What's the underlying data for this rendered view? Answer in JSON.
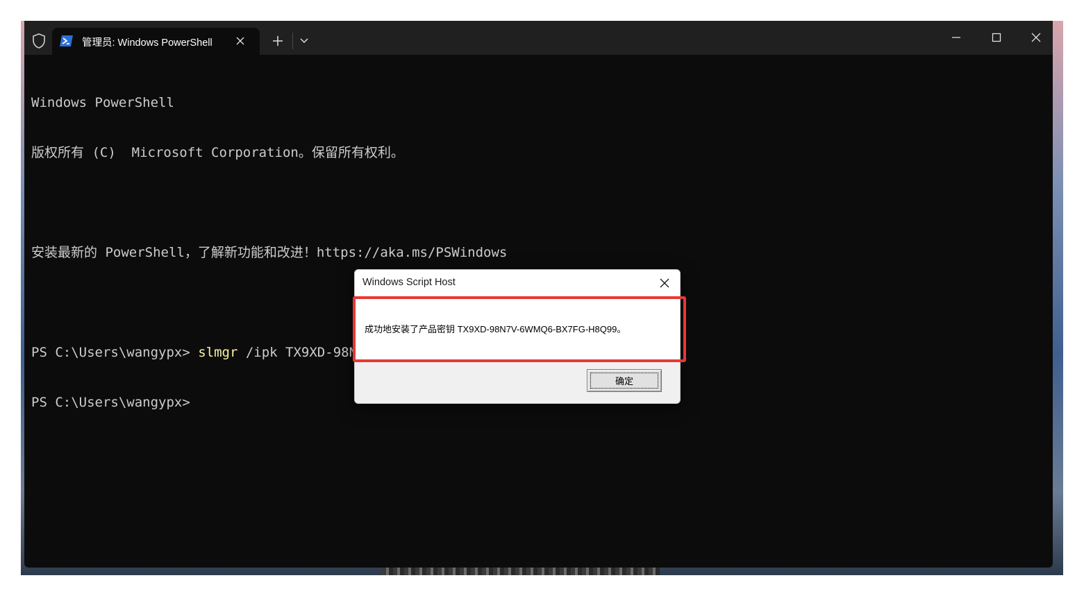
{
  "tab": {
    "title": "管理员: Windows PowerShell"
  },
  "console": {
    "lines": [
      "Windows PowerShell",
      "版权所有 (C)  Microsoft Corporation。保留所有权利。",
      "",
      "安装最新的 PowerShell，了解新功能和改进！https://aka.ms/PSWindows",
      ""
    ],
    "prompt1": "PS C:\\Users\\wangypx> ",
    "command": "slmgr",
    "command_args": " /ipk TX9XD-98N7V-6WMQ6-BX7FG-H8Q99",
    "prompt2": "PS C:\\Users\\wangypx>"
  },
  "dialog": {
    "title": "Windows Script Host",
    "message": "成功地安装了产品密钥 TX9XD-98N7V-6WMQ6-BX7FG-H8Q99。",
    "ok_label": "确定"
  },
  "colors": {
    "terminal_bg": "#0c0c0c",
    "tabbar_bg": "#202020",
    "command_color": "#f9f1a5",
    "highlight": "#e53935"
  },
  "icons": {
    "shield": "shield-icon",
    "powershell": "powershell-icon",
    "close": "close-icon",
    "plus": "plus-icon",
    "dropdown": "chevron-down-icon",
    "minimize": "minimize-icon",
    "maximize": "maximize-icon"
  }
}
